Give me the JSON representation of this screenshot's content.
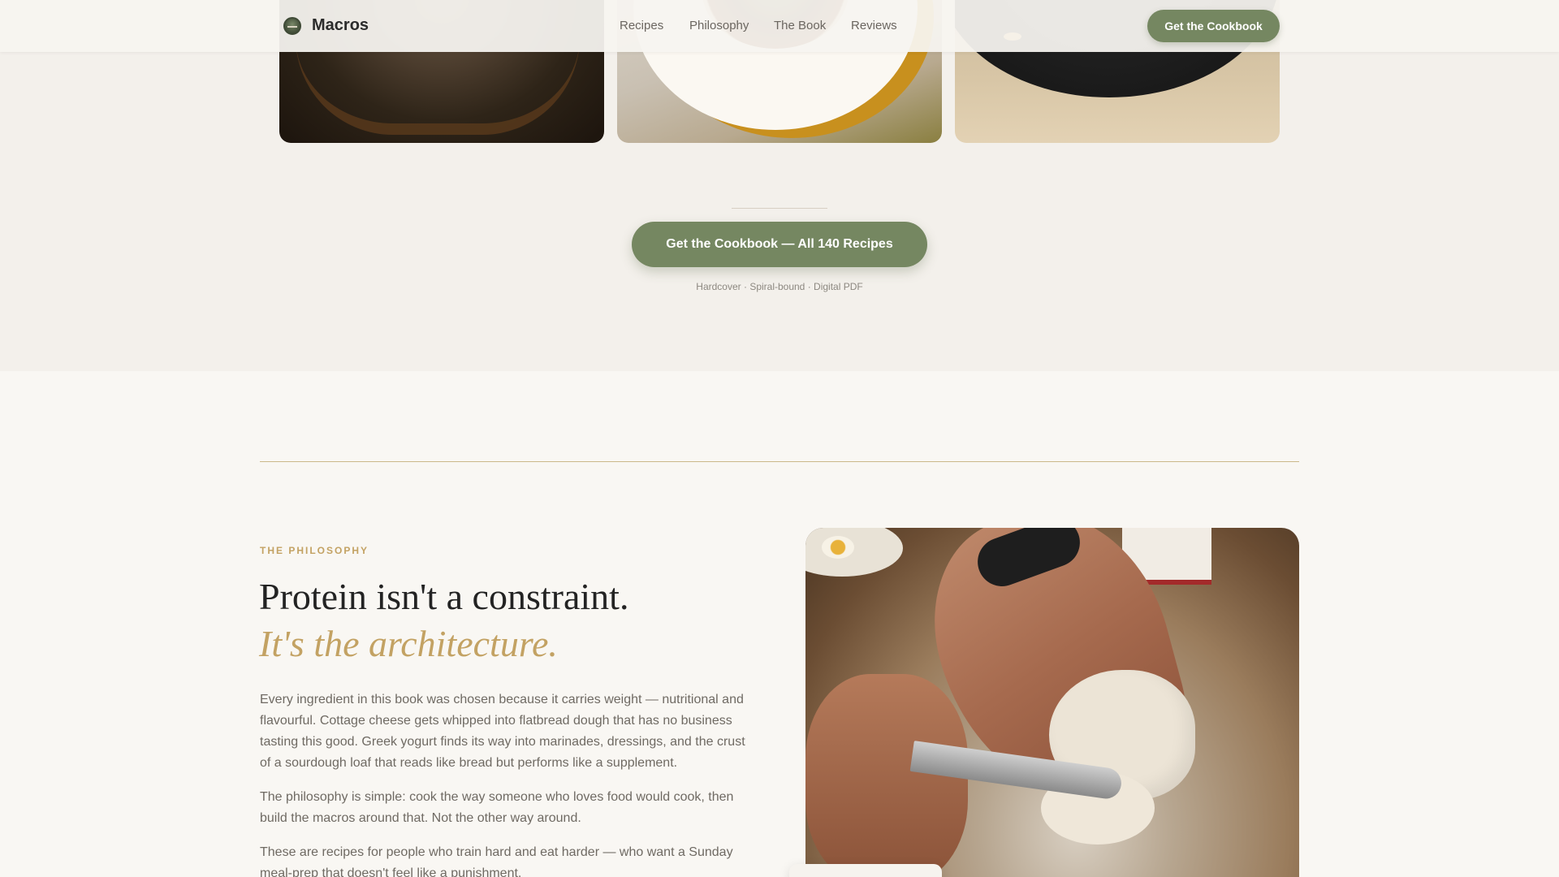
{
  "header": {
    "brand": "Macros",
    "nav": [
      "Recipes",
      "Philosophy",
      "The Book",
      "Reviews"
    ],
    "cta": "Get the Cookbook"
  },
  "gallery": {
    "cta": "Get the Cookbook — All 140 Recipes",
    "formats": "Hardcover · Spiral-bound · Digital PDF"
  },
  "philosophy": {
    "eyebrow": "THE PHILOSOPHY",
    "headline": "Protein isn't a constraint.",
    "headline_accent": "It's the architecture.",
    "paragraphs": [
      "Every ingredient in this book was chosen because it carries weight — nutritional and flavourful. Cottage cheese gets whipped into flatbread dough that has no business tasting this good. Greek yogurt finds its way into marinades, dressings, and the crust of a sourdough loaf that reads like bread but performs like a supplement.",
      "The philosophy is simple: cook the way someone who loves food would cook, then build the macros around that. Not the other way around.",
      "These are recipes for people who train hard and eat harder — who want a Sunday meal-prep that doesn't feel like a punishment."
    ]
  },
  "colors": {
    "accent_green": "#758761",
    "accent_gold": "#c3a263",
    "background": "#f9f7f3"
  }
}
